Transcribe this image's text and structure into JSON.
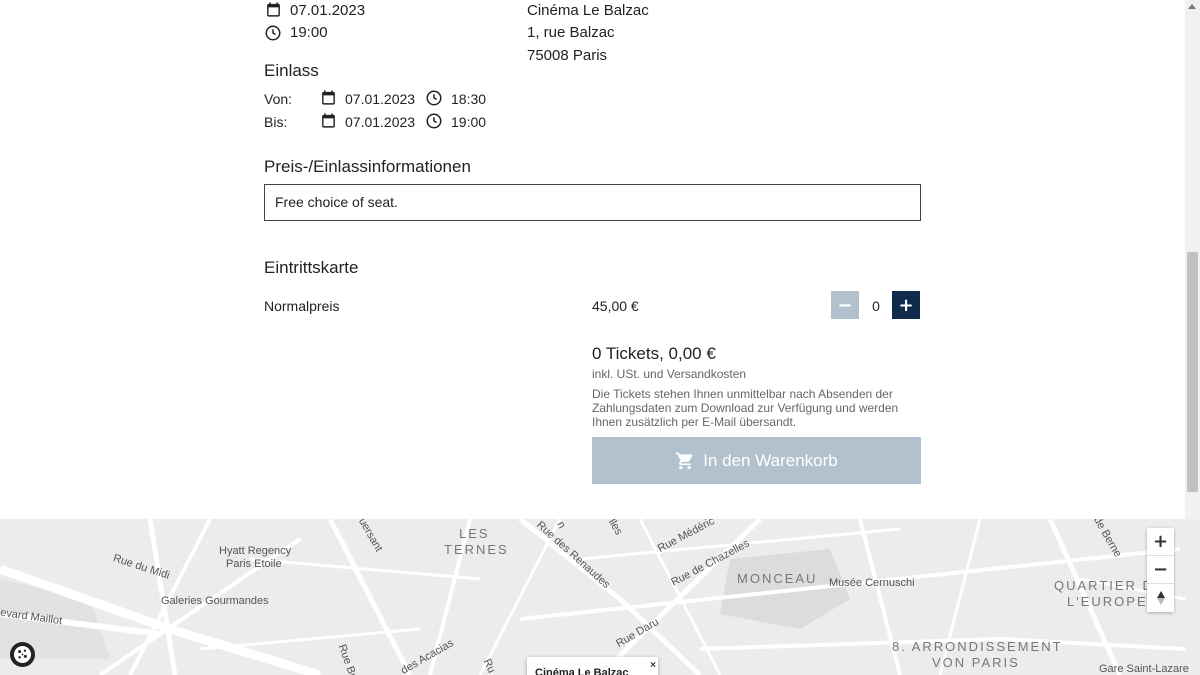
{
  "event": {
    "date": "07.01.2023",
    "time": "19:00"
  },
  "venue": {
    "name": "Cinéma Le Balzac",
    "street": "1, rue Balzac",
    "city": "75008 Paris"
  },
  "admission": {
    "heading": "Einlass",
    "from_label": "Von:",
    "from_date": "07.01.2023",
    "from_time": "18:30",
    "to_label": "Bis:",
    "to_date": "07.01.2023",
    "to_time": "19:00"
  },
  "price_info": {
    "heading": "Preis-/Einlassinformationen",
    "text": "Free choice of seat."
  },
  "tickets": {
    "heading": "Eintrittskarte",
    "rows": [
      {
        "name": "Normalpreis",
        "price": "45,00 €",
        "quantity": "0"
      }
    ],
    "minus_label": "−",
    "plus_label": "+"
  },
  "summary": {
    "total": "0 Tickets, 0,00 €",
    "tax_note": "inkl. USt. und Versandkosten",
    "delivery_note": "Die Tickets stehen Ihnen unmittelbar nach Absenden der Zahlungsdaten zum Download zur Verfügung und werden Ihnen zusätzlich per E-Mail übersandt.",
    "cart_button": "In den Warenkorb"
  },
  "map": {
    "zoom_in": "+",
    "zoom_out": "−",
    "labels": [
      "Hyatt Regency",
      "Paris Etoile",
      "Rue du Midi",
      "Galeries Gourmandes",
      "evard Maillot",
      "Rue des Renaudes",
      "Rue Médéric",
      "Rue de Chazelles",
      "Musée Cernuschi",
      "Rue Daru",
      "des Acacias",
      "Gare Saint-Lazare",
      "uersant",
      "Rue Br",
      "Ru",
      "de Berne",
      "lles",
      "n"
    ],
    "districts": [
      "LES",
      "TERNES",
      "MONCEAU",
      "QUARTIER D",
      "L'EUROPE",
      "8. ARRONDISSEMENT",
      "VON PARIS"
    ],
    "popup_title": "Cinéma Le Balzac",
    "popup_close": "×"
  },
  "colors": {
    "primary": "#0f2a4c",
    "disabled": "#b3c1cf",
    "map_bg": "#ececec"
  }
}
